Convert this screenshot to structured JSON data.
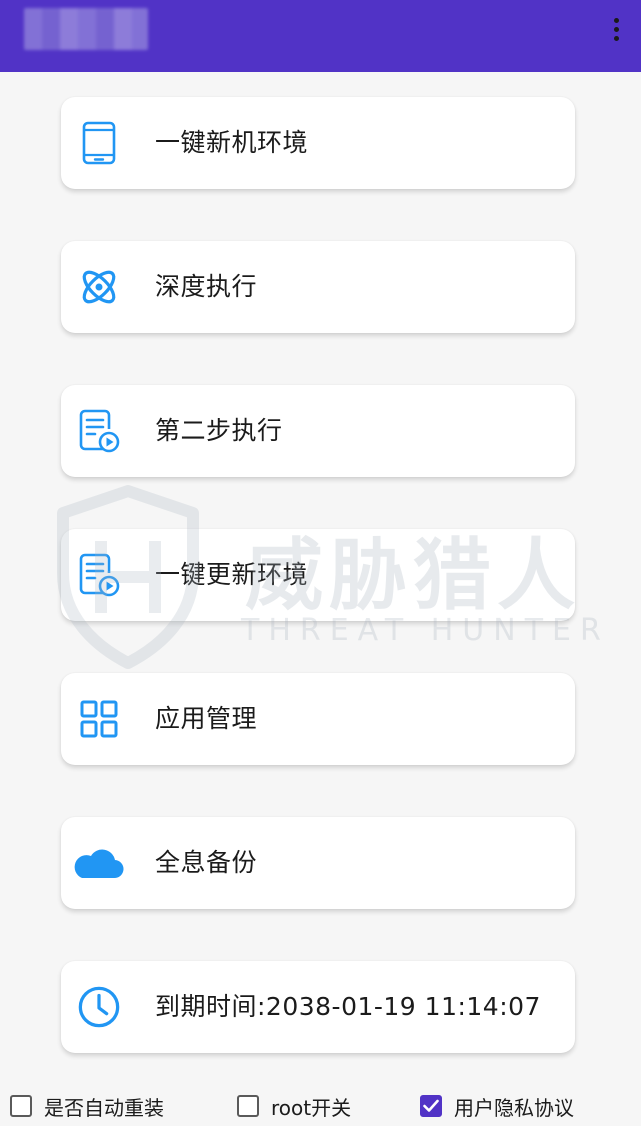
{
  "colors": {
    "appbar": "#5133c6",
    "icon_blue": "#2196f3",
    "checkbox_checked": "#5133c6"
  },
  "appbar": {
    "menu_icon": "more-vert-icon"
  },
  "menu": [
    {
      "label": "一键新机环境",
      "icon": "phone-icon"
    },
    {
      "label": "深度执行",
      "icon": "atom-icon"
    },
    {
      "label": "第二步执行",
      "icon": "document-play-icon"
    },
    {
      "label": "一键更新环境",
      "icon": "document-play-icon"
    },
    {
      "label": "应用管理",
      "icon": "grid-icon"
    },
    {
      "label": "全息备份",
      "icon": "cloud-icon"
    },
    {
      "label": "到期时间:2038-01-19 11:14:07",
      "icon": "clock-icon"
    }
  ],
  "watermark": {
    "cn": "威胁猎人",
    "en": "THREAT HUNTER"
  },
  "options": [
    {
      "label": "是否自动重装",
      "checked": false
    },
    {
      "label": "root开关",
      "checked": false
    },
    {
      "label": "用户隐私协议",
      "checked": true
    }
  ]
}
